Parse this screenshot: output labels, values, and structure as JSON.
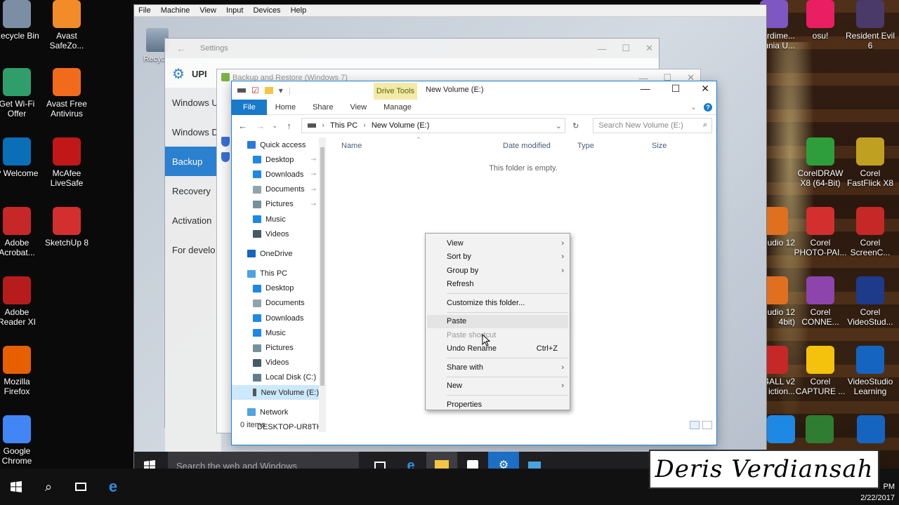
{
  "host": {
    "left_icons": [
      {
        "label": "Recycle Bin",
        "icon": "recycle-bin-icon",
        "color": "#7b8ea3"
      },
      {
        "label": "Get Wi-Fi Offer",
        "icon": "wifi-offer-icon",
        "color": "#2f9e6a"
      },
      {
        "label": "P Welcome",
        "icon": "hp-icon",
        "color": "#0a6fb7"
      },
      {
        "label": "Adobe Acrobat...",
        "icon": "acrobat-icon",
        "color": "#c62828"
      },
      {
        "label": "Adobe Reader XI",
        "icon": "acrobat-reader-icon",
        "color": "#b71c1c"
      },
      {
        "label": "Mozilla Firefox",
        "icon": "firefox-icon",
        "color": "#e66000"
      },
      {
        "label": "Google Chrome",
        "icon": "chrome-icon",
        "color": "#4285f4"
      }
    ],
    "second_icons": [
      {
        "label": "Avast SafeZo...",
        "icon": "avast-safezone-icon",
        "color": "#f28c28"
      },
      {
        "label": "Avast Free Antivirus",
        "icon": "avast-icon",
        "color": "#f26b1d"
      },
      {
        "label": "McAfee LiveSafe",
        "icon": "mcafee-icon",
        "color": "#c01818"
      },
      {
        "label": "SketchUp 8",
        "icon": "sketchup-icon",
        "color": "#d32f2f"
      }
    ],
    "right_icons": [
      {
        "label": "rdime... unia U...",
        "icon": "app-icon",
        "color": "#7e57c2"
      },
      {
        "label": "osu!",
        "icon": "osu-icon",
        "color": "#e91e63"
      },
      {
        "label": "Resident Evil 6",
        "icon": "resident-evil-icon",
        "color": "#4a3a6a"
      },
      {
        "label": "CorelDRAW X8 (64-Bit)",
        "icon": "coreldraw-icon",
        "color": "#2e9e3c"
      },
      {
        "label": "Corel FastFlick X8",
        "icon": "fastflick-icon",
        "color": "#c0a020"
      },
      {
        "label": "udio 12",
        "icon": "studio-icon",
        "color": "#e07020"
      },
      {
        "label": "Corel PHOTO-PAI...",
        "icon": "photopaint-icon",
        "color": "#d32f2f"
      },
      {
        "label": "Corel ScreenC...",
        "icon": "screencap-icon",
        "color": "#c62828"
      },
      {
        "label": "udio 12 4bit)",
        "icon": "studio64-icon",
        "color": "#e07020"
      },
      {
        "label": "Corel CONNE...",
        "icon": "connect-icon",
        "color": "#8e44ad"
      },
      {
        "label": "Corel VideoStud...",
        "icon": "videostudio-icon",
        "color": "#1e3a8a"
      },
      {
        "label": "4ALL v2 iction...",
        "icon": "pdf-icon",
        "color": "#c62828"
      },
      {
        "label": "Corel CAPTURE ...",
        "icon": "capture-icon",
        "color": "#f4c20d"
      },
      {
        "label": "VideoStudio Learning",
        "icon": "learning-icon",
        "color": "#1565c0"
      }
    ],
    "clock_time": "PM",
    "clock_date": "2/22/2017",
    "watermark": "Deris Verdiansah"
  },
  "vm": {
    "menu": [
      "File",
      "Machine",
      "View",
      "Input",
      "Devices",
      "Help"
    ],
    "guest_desktop_icon": "Recycle",
    "taskbar_search": "Search the web and Windows",
    "settings": {
      "title": "Settings",
      "heading": "UPI",
      "nav": [
        "Windows U",
        "Windows D",
        "Backup",
        "Recovery",
        "Activation",
        "For develo"
      ],
      "active_index": 2
    },
    "backup_title": "Backup and Restore (Windows 7)",
    "explorer": {
      "contextual_tab": "Drive Tools",
      "title": "New Volume (E:)",
      "ribbon_tabs": [
        "File",
        "Home",
        "Share",
        "View",
        "Manage"
      ],
      "address_crumbs": [
        "This PC",
        "New Volume (E:)"
      ],
      "search_placeholder": "Search New Volume (E:)",
      "nav": [
        {
          "label": "Quick access",
          "icon": "star-icon",
          "color": "#2b79d8",
          "level": 0
        },
        {
          "label": "Desktop",
          "icon": "desktop-folder-icon",
          "color": "#1e88e5",
          "level": 1,
          "pinned": true
        },
        {
          "label": "Downloads",
          "icon": "downloads-icon",
          "color": "#1e88e5",
          "level": 1,
          "pinned": true
        },
        {
          "label": "Documents",
          "icon": "documents-icon",
          "color": "#90a4ae",
          "level": 1,
          "pinned": true
        },
        {
          "label": "Pictures",
          "icon": "pictures-icon",
          "color": "#78909c",
          "level": 1,
          "pinned": true
        },
        {
          "label": "Music",
          "icon": "music-icon",
          "color": "#1e88e5",
          "level": 1
        },
        {
          "label": "Videos",
          "icon": "videos-icon",
          "color": "#455a64",
          "level": 1
        },
        {
          "label": "OneDrive",
          "icon": "onedrive-icon",
          "color": "#1565c0",
          "level": 0,
          "gap": true
        },
        {
          "label": "This PC",
          "icon": "this-pc-icon",
          "color": "#4fa3e0",
          "level": 0,
          "gap": true
        },
        {
          "label": "Desktop",
          "icon": "desktop-folder-icon",
          "color": "#1e88e5",
          "level": 1
        },
        {
          "label": "Documents",
          "icon": "documents-icon",
          "color": "#90a4ae",
          "level": 1
        },
        {
          "label": "Downloads",
          "icon": "downloads-icon",
          "color": "#1e88e5",
          "level": 1
        },
        {
          "label": "Music",
          "icon": "music-icon",
          "color": "#1e88e5",
          "level": 1
        },
        {
          "label": "Pictures",
          "icon": "pictures-icon",
          "color": "#78909c",
          "level": 1
        },
        {
          "label": "Videos",
          "icon": "videos-icon",
          "color": "#455a64",
          "level": 1
        },
        {
          "label": "Local Disk (C:)",
          "icon": "local-disk-icon",
          "color": "#607d8b",
          "level": 1
        },
        {
          "label": "New Volume (E:)",
          "icon": "drive-icon",
          "color": "#555555",
          "level": 1,
          "selected": true
        },
        {
          "label": "Network",
          "icon": "network-icon",
          "color": "#4fa3e0",
          "level": 0,
          "gap": true
        },
        {
          "label": "DESKTOP-UR8TH",
          "icon": "computer-icon",
          "color": "#4fa3e0",
          "level": 1
        }
      ],
      "columns": [
        "Name",
        "Date modified",
        "Type",
        "Size"
      ],
      "empty_message": "This folder is empty.",
      "status": "0 items"
    },
    "context_menu": [
      {
        "label": "View",
        "submenu": true
      },
      {
        "label": "Sort by",
        "submenu": true
      },
      {
        "label": "Group by",
        "submenu": true
      },
      {
        "label": "Refresh"
      },
      {
        "separator": true
      },
      {
        "label": "Customize this folder..."
      },
      {
        "separator": true
      },
      {
        "label": "Paste",
        "hover": true
      },
      {
        "label": "Paste shortcut",
        "disabled": true
      },
      {
        "label": "Undo Rename",
        "shortcut": "Ctrl+Z"
      },
      {
        "separator": true
      },
      {
        "label": "Share with",
        "submenu": true
      },
      {
        "separator": true
      },
      {
        "label": "New",
        "submenu": true
      },
      {
        "separator": true
      },
      {
        "label": "Properties"
      }
    ]
  },
  "host_taskbar": {
    "search_label": "Search the web and Windows"
  }
}
